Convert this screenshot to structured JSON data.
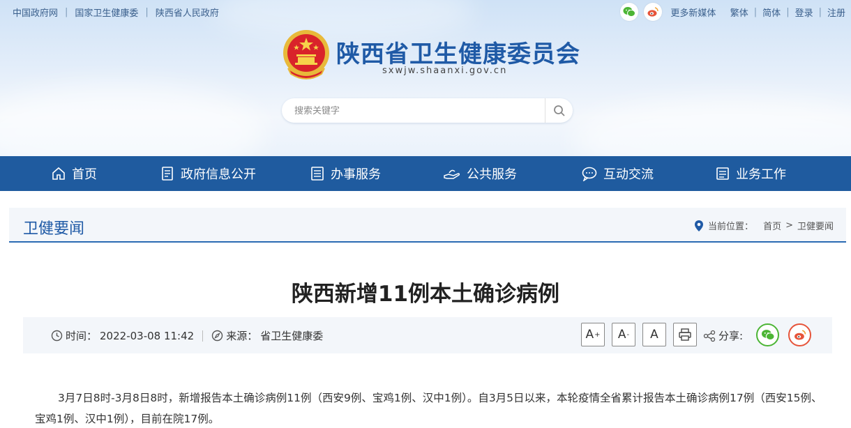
{
  "top_links": [
    "中国政府网",
    "国家卫生健康委",
    "陕西省人民政府"
  ],
  "top_right": {
    "icons": [
      "wechat-icon",
      "weibo-icon"
    ],
    "links": [
      "更多新媒体",
      "繁体",
      "简体",
      "登录",
      "注册"
    ]
  },
  "site": {
    "title": "陕西省卫生健康委员会",
    "url": "sxwjw.shaanxi.gov.cn"
  },
  "search": {
    "placeholder": "搜索关键字"
  },
  "nav": [
    {
      "label": "首页",
      "icon": "home-icon"
    },
    {
      "label": "政府信息公开",
      "icon": "document-icon"
    },
    {
      "label": "办事服务",
      "icon": "list-icon"
    },
    {
      "label": "公共服务",
      "icon": "hand-icon"
    },
    {
      "label": "互动交流",
      "icon": "chat-icon"
    },
    {
      "label": "业务工作",
      "icon": "folder-icon"
    }
  ],
  "section": {
    "title": "卫健要闻",
    "breadcrumb_prefix": "当前位置：",
    "crumbs": [
      "首页",
      "卫健要闻"
    ],
    "crumb_sep": ">"
  },
  "article": {
    "title": "陕西新增11例本土确诊病例",
    "time_label": "时间：",
    "time": "2022-03-08 11:42",
    "source_label": "来源：",
    "source": "省卫生健康委",
    "font_buttons": [
      "A",
      "A",
      "A"
    ],
    "share_label": "分享:",
    "body": "3月7日8时-3月8日8时，新增报告本土确诊病例11例（西安9例、宝鸡1例、汉中1例）。自3月5日以来，本轮疫情全省累计报告本土确诊病例17例（西安15例、宝鸡1例、汉中1例），目前在院17例。"
  },
  "colors": {
    "nav_bg": "#1f5b9f",
    "title_blue": "#1f5aa6",
    "wechat_green": "#4cb535",
    "weibo_red": "#e6543a"
  }
}
